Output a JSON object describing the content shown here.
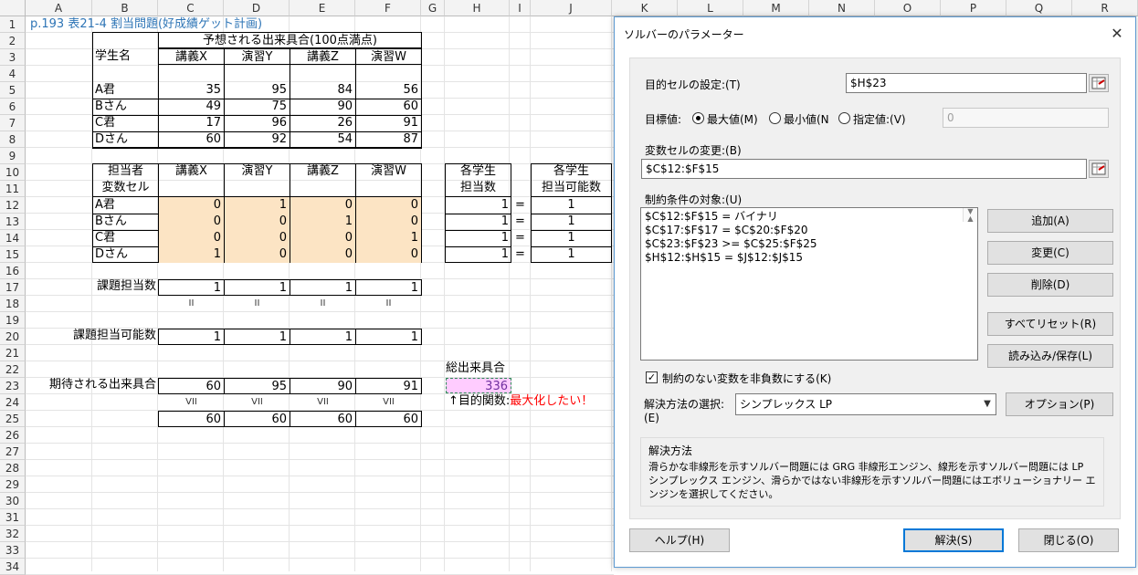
{
  "columns": [
    "A",
    "B",
    "C",
    "D",
    "E",
    "F",
    "G",
    "H",
    "I",
    "J",
    "K",
    "L",
    "M",
    "N",
    "O",
    "P",
    "Q",
    "R"
  ],
  "rows": [
    "1",
    "2",
    "3",
    "4",
    "5",
    "6",
    "7",
    "8",
    "9",
    "10",
    "11",
    "12",
    "13",
    "14",
    "15",
    "16",
    "17",
    "18",
    "19",
    "20",
    "21",
    "22",
    "23",
    "24",
    "25",
    "26",
    "27",
    "28",
    "29",
    "30",
    "31",
    "32",
    "33",
    "34"
  ],
  "sheet": {
    "title": "p.193 表21-4 割当問題(好成績ゲット計画)",
    "header_expected": "予想される出来具合(100点満点)",
    "student_name": "学生名",
    "subjects": [
      "講義X",
      "演習Y",
      "講義Z",
      "演習W"
    ],
    "students": [
      "A君",
      "Bさん",
      "C君",
      "Dさん"
    ],
    "scores": [
      [
        "35",
        "95",
        "84",
        "56"
      ],
      [
        "49",
        "75",
        "90",
        "60"
      ],
      [
        "17",
        "96",
        "26",
        "91"
      ],
      [
        "60",
        "92",
        "54",
        "87"
      ]
    ],
    "assignee": "担当者",
    "var_cells": "変数セル",
    "vars": [
      [
        "0",
        "1",
        "0",
        "0"
      ],
      [
        "0",
        "0",
        "1",
        "0"
      ],
      [
        "0",
        "0",
        "0",
        "1"
      ],
      [
        "1",
        "0",
        "0",
        "0"
      ]
    ],
    "each_student": "各学生",
    "assign_count": "担当数",
    "assign_possible": "担当可能数",
    "counts": [
      "1",
      "1",
      "1",
      "1"
    ],
    "eq": "=",
    "possible": [
      "1",
      "1",
      "1",
      "1"
    ],
    "task_count_label": "課題担当数",
    "task_counts": [
      "1",
      "1",
      "1",
      "1"
    ],
    "eq_sym": "II",
    "task_possible_label": "課題担当可能数",
    "task_possible": [
      "1",
      "1",
      "1",
      "1"
    ],
    "total_label": "総出来具合",
    "expected_label": "期待される出来具合",
    "expected": [
      "60",
      "95",
      "90",
      "91"
    ],
    "total_value": "336",
    "ge_sym": "VII",
    "objective_prefix": "↑目的関数:",
    "objective_red": "最大化したい！",
    "mins": [
      "60",
      "60",
      "60",
      "60"
    ]
  },
  "dialog": {
    "title": "ソルバーのパラメーター",
    "close": "✕",
    "objective_label": "目的セルの設定:(T)",
    "objective_value": "$H$23",
    "target_label": "目標値:",
    "opt_max": "最大値(M)",
    "opt_min": "最小値(N",
    "opt_value": "指定値:(V)",
    "value_field": "0",
    "var_label": "変数セルの変更:(B)",
    "var_value": "$C$12:$F$15",
    "constraints_label": "制約条件の対象:(U)",
    "constraints": [
      "$C$12:$F$15 = バイナリ",
      "$C$17:$F$17 = $C$20:$F$20",
      "$C$23:$F$23 >= $C$25:$F$25",
      "$H$12:$H$15 = $J$12:$J$15"
    ],
    "btn_add": "追加(A)",
    "btn_change": "変更(C)",
    "btn_delete": "削除(D)",
    "btn_reset": "すべてリセット(R)",
    "btn_load": "読み込み/保存(L)",
    "nonneg": "制約のない変数を非負数にする(K)",
    "method_label": "解決方法の選択:",
    "method_label2": "(E)",
    "method_value": "シンプレックス LP",
    "btn_options": "オプション(P)",
    "method_group_title": "解決方法",
    "method_desc": "滑らかな非線形を示すソルバー問題には GRG 非線形エンジン、線形を示すソルバー問題には LP シンプレックス エンジン、滑らかではない非線形を示すソルバー問題にはエボリューショナリー エンジンを選択してください。",
    "btn_help": "ヘルプ(H)",
    "btn_solve": "解決(S)",
    "btn_close": "閉じる(O)"
  }
}
